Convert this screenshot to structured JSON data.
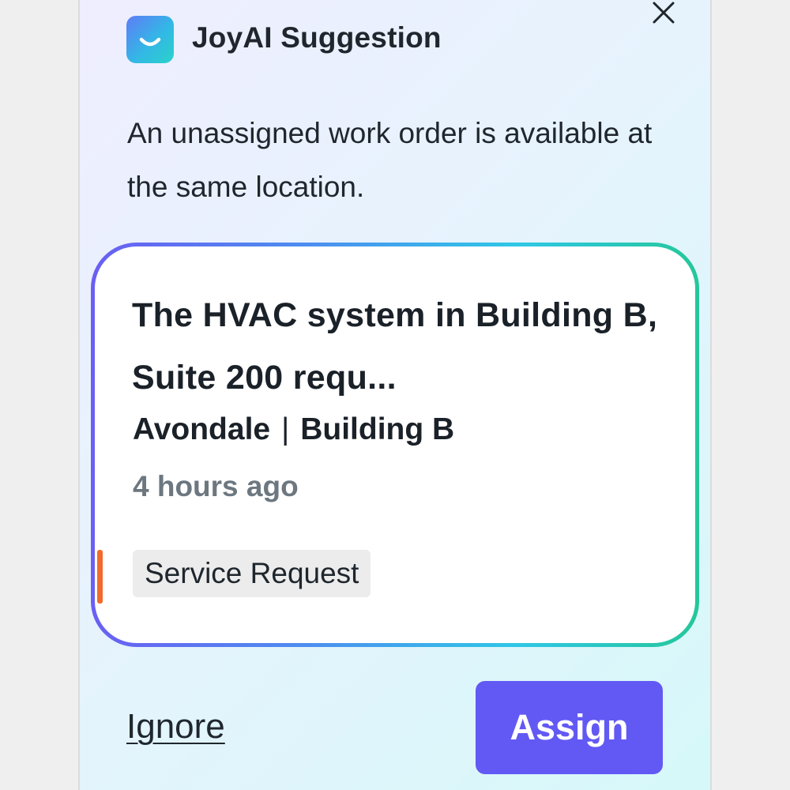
{
  "header": {
    "title": "JoyAI Suggestion",
    "icon": "smile-icon",
    "close_icon": "close-icon"
  },
  "message": "An unassigned work order is available at the same location.",
  "work_order": {
    "title": "The HVAC system in Building B, Suite 200 requ...",
    "site": "Avondale",
    "separator": "|",
    "building": "Building B",
    "time_ago": "4 hours ago",
    "type_tag": "Service Request",
    "priority_color": "#f16a2c"
  },
  "actions": {
    "ignore_label": "Ignore",
    "assign_label": "Assign"
  },
  "colors": {
    "accent": "#6259f4",
    "card_gradient_start": "#6a5ff2",
    "card_gradient_end": "#25c79a"
  }
}
